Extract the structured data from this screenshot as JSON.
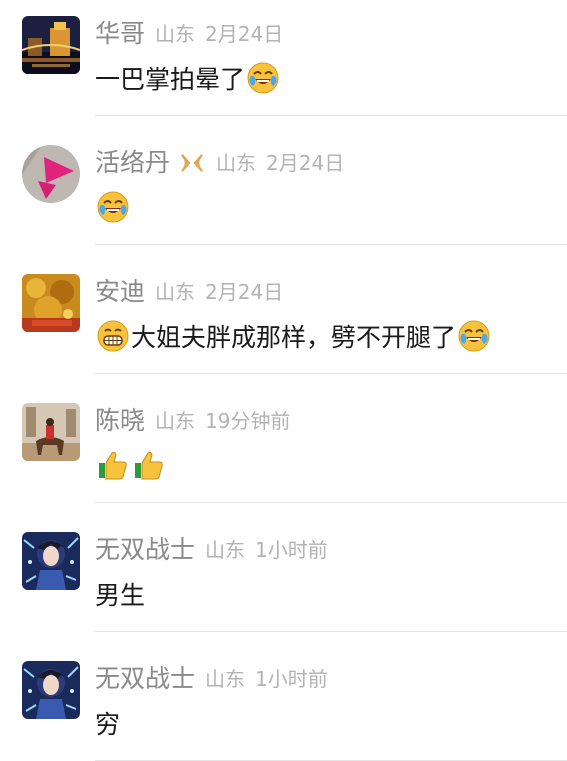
{
  "comments": [
    {
      "name": "华哥",
      "region": "山东",
      "time": "2月24日",
      "text": "一巴掌拍晕了",
      "trailing_emoji": "laughing-crying-emoji"
    },
    {
      "name": "活络丹",
      "badge": "ribbon-badge-icon",
      "region": "山东",
      "time": "2月24日",
      "text": "",
      "trailing_emoji": "laughing-crying-emoji"
    },
    {
      "name": "安迪",
      "region": "山东",
      "time": "2月24日",
      "leading_emoji": "grinning-emoji",
      "text": "大姐夫胖成那样，劈不开腿了",
      "trailing_emoji": "laughing-crying-emoji"
    },
    {
      "name": "陈晓",
      "region": "山东",
      "time": "19分钟前",
      "text": "",
      "emojis": [
        "thumbs-up-emoji",
        "thumbs-up-emoji"
      ]
    },
    {
      "name": "无双战士",
      "region": "山东",
      "time": "1小时前",
      "text": "男生"
    },
    {
      "name": "无双战士",
      "region": "山东",
      "time": "1小时前",
      "text": "穷"
    }
  ],
  "colors": {
    "name": "#8a8a8a",
    "meta": "#b3b3b3",
    "content": "#1a1a1a",
    "divider": "#e4e4e4",
    "badge": "#e0a855"
  }
}
